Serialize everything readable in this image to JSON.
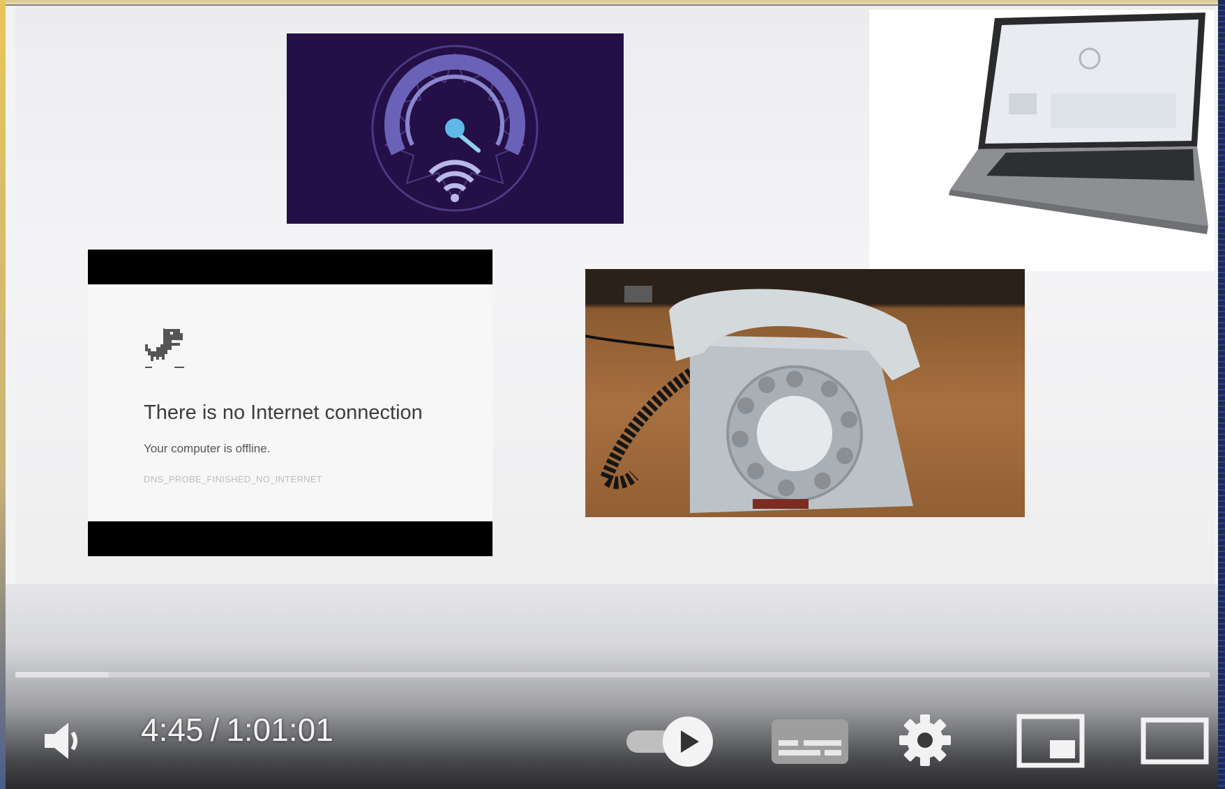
{
  "offline_dialog": {
    "title": "There is no Internet connection",
    "subtitle": "Your computer is offline.",
    "error_code": "DNS_PROBE_FINISHED_NO_INTERNET"
  },
  "player": {
    "current_time": "4:45",
    "separator": "/",
    "duration": "1:01:01",
    "progress_fraction": 0.078,
    "autoplay_on": true,
    "icons": {
      "volume": "volume-icon",
      "autoplay": "autoplay-toggle-icon",
      "subtitles": "subtitles-icon",
      "settings": "gear-icon",
      "miniplayer": "miniplayer-icon",
      "theater": "theater-mode-icon"
    }
  },
  "colors": {
    "speed_bg": "#241046",
    "speed_accent": "#5fb8e8",
    "control_icon": "#f2f2f2"
  }
}
